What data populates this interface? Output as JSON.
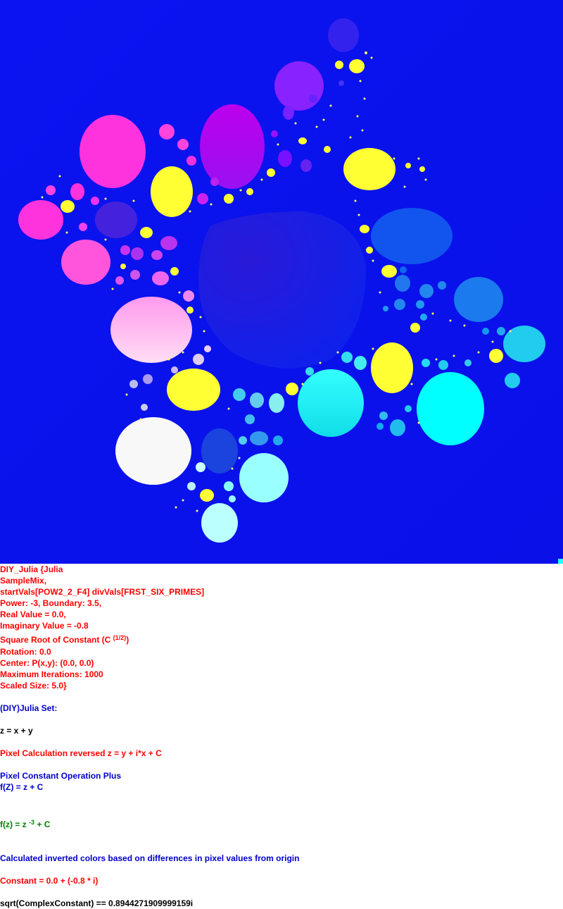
{
  "fractal": {
    "background_color": "#0a14f0",
    "palette": [
      "#ff33dd",
      "#bb00ff",
      "#ffff33",
      "#ffffff",
      "#00ffff",
      "#1a66ee",
      "#ffccff"
    ]
  },
  "info": {
    "l1": "DIY_Julia {Julia",
    "l2": "SampleMix,",
    "l3": "startVals[POW2_2_F4] divVals[FRST_SIX_PRIMES]",
    "l4": "Power: -3, Boundary: 3.5,",
    "l5": "Real Value = 0.0,",
    "l6": "Imaginary Value = -0.8",
    "l7a": "Square Root of Constant (C ",
    "l7sup": "(1/2)",
    "l7b": ")",
    "l8": "Rotation: 0.0",
    "l9": "Center: P(x,y): (0.0, 0.0)",
    "l10": "Maximum Iterations: 1000",
    "l11": "Scaled Size: 5.0}",
    "l12": "(DIY)Julia Set:",
    "l13": "z = x + y",
    "l14": "Pixel Calculation reversed z = y + i*x + C",
    "l15": "Pixel Constant Operation Plus",
    "l16": "f(Z) = z + C",
    "l17a": "f(z) = z ",
    "l17sup": "-3",
    "l17b": " + C",
    "l18": "Calculated inverted colors based on differences in pixel values from origin",
    "l19": "Constant = 0.0 + (-0.8 * i)",
    "l20": "sqrt(ComplexConstant) == 0.8944271909999159i"
  }
}
